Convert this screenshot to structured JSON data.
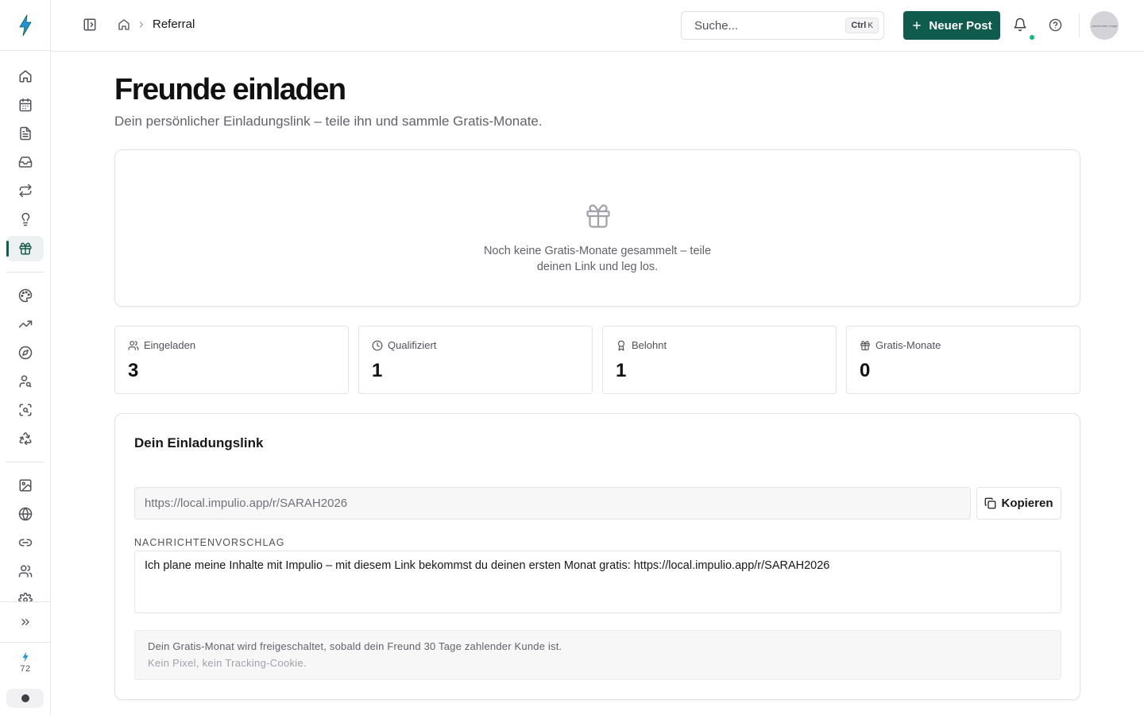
{
  "header": {
    "breadcrumb_current": "Referral",
    "search_placeholder": "Suche...",
    "search_shortcut": "Ctrl",
    "search_shortcut_key": "K",
    "new_post_label": "Neuer Post",
    "avatar_text": "placeholder image"
  },
  "sidebar": {
    "items": [
      {
        "icon": "home-icon"
      },
      {
        "icon": "calendar-icon"
      },
      {
        "icon": "document-icon"
      },
      {
        "icon": "inbox-icon"
      },
      {
        "icon": "repeat-icon"
      },
      {
        "icon": "lightbulb-icon"
      },
      {
        "icon": "gift-icon",
        "active": true
      },
      {
        "icon": "palette-icon"
      },
      {
        "icon": "trending-up-icon"
      },
      {
        "icon": "compass-icon"
      },
      {
        "icon": "user-search-icon"
      },
      {
        "icon": "scan-search-icon"
      },
      {
        "icon": "recycle-icon"
      },
      {
        "icon": "image-icon"
      },
      {
        "icon": "globe-icon"
      },
      {
        "icon": "link-icon"
      },
      {
        "icon": "users-icon"
      },
      {
        "icon": "settings-icon"
      }
    ],
    "credits": "72"
  },
  "page": {
    "title": "Freunde einladen",
    "subtitle": "Dein persönlicher Einladungslink – teile ihn und sammle Gratis-Monate."
  },
  "hero": {
    "empty_text": "Noch keine Gratis-Monate gesammelt – teile deinen Link und leg los."
  },
  "stats": [
    {
      "label": "Eingeladen",
      "value": "3",
      "icon": "users-icon"
    },
    {
      "label": "Qualifiziert",
      "value": "1",
      "icon": "clock-icon"
    },
    {
      "label": "Belohnt",
      "value": "1",
      "icon": "award-icon"
    },
    {
      "label": "Gratis-Monate",
      "value": "0",
      "icon": "gift-icon"
    }
  ],
  "invite": {
    "title": "Dein Einladungslink",
    "link": "https://local.impulio.app/r/SARAH2026",
    "copy_label": "Kopieren",
    "message_label": "NACHRICHTENVORSCHLAG",
    "message": "Ich plane meine Inhalte mit Impulio – mit diesem Link bekommst du deinen ersten Monat gratis: https://local.impulio.app/r/SARAH2026",
    "note_1": "Dein Gratis-Monat wird freigeschaltet, sobald dein Freund 30 Tage zahlender Kunde ist.",
    "note_2": "Kein Pixel, kein Tracking-Cookie."
  },
  "colors": {
    "accent": "#0f5b4e",
    "notification_dot": "#10b981"
  }
}
